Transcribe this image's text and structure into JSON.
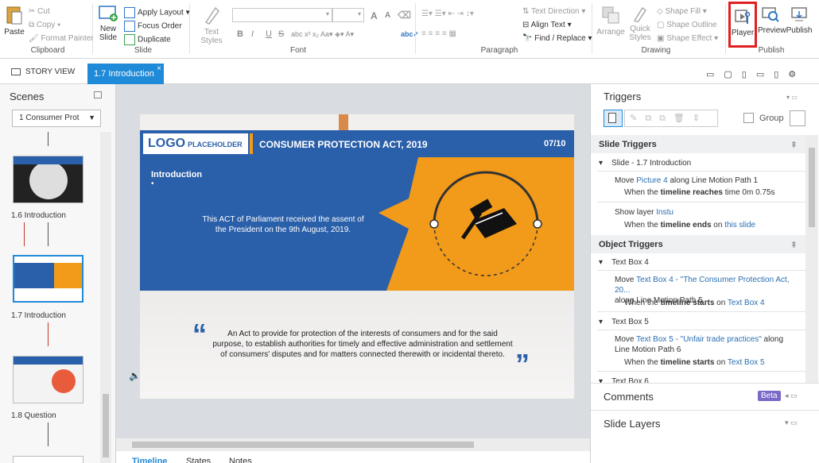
{
  "ribbon": {
    "clipboard": {
      "paste": "Paste",
      "cut": "Cut",
      "copy": "Copy",
      "format_painter": "Format Painter",
      "label": "Clipboard"
    },
    "slide": {
      "new_slide": "New",
      "new_slide2": "Slide",
      "apply_layout": "Apply Layout",
      "focus_order": "Focus Order",
      "duplicate": "Duplicate",
      "label": "Slide"
    },
    "font": {
      "text_styles": "Text Styles",
      "label": "Font",
      "bold": "B",
      "italic": "I",
      "underline": "U",
      "strike": "S",
      "grow": "A",
      "shrink": "A"
    },
    "paragraph": {
      "text_direction": "Text Direction",
      "align_text": "Align Text",
      "find_replace": "Find / Replace",
      "label": "Paragraph"
    },
    "drawing": {
      "arrange": "Arrange",
      "quick_styles": "Quick",
      "quick_styles2": "Styles",
      "shape_fill": "Shape Fill",
      "shape_outline": "Shape Outline",
      "shape_effect": "Shape Effect",
      "label": "Drawing"
    },
    "publish": {
      "player": "Player",
      "preview": "Preview",
      "publish": "Publish",
      "label": "Publish"
    }
  },
  "tabs": {
    "story_view": "STORY VIEW",
    "active": "1.7 Introduction",
    "close": "×"
  },
  "scenes": {
    "title": "Scenes",
    "selector": "1 Consumer Prot",
    "items": [
      {
        "label": "1.6 Introduction"
      },
      {
        "label": "1.7 Introduction"
      },
      {
        "label": "1.8 Question"
      }
    ]
  },
  "slide": {
    "logo": "LOGO",
    "logo_sub": "PLACEHOLDER",
    "header_title": "CONSUMER PROTECTION ACT, 2019",
    "page": "07/10",
    "intro_title": "Introduction",
    "bullet": "•",
    "intro_text_1": "This ACT of Parliament received the assent of",
    "intro_text_2": "the President on the 9th August, 2019.",
    "quote_1": "An Act to provide for protection of the interests of consumers and for the said",
    "quote_2": "purpose, to establish authorities for timely and effective administration and settlement",
    "quote_3": "of consumers' disputes and for matters connected therewith or incidental thereto.",
    "quote_open": "“",
    "quote_close": "”"
  },
  "bottom_tabs": {
    "timeline": "Timeline",
    "states": "States",
    "notes": "Notes"
  },
  "triggers": {
    "title": "Triggers",
    "group": "Group",
    "slide_triggers": "Slide Triggers",
    "slide_name": "Slide - 1.7 Introduction",
    "t1_a": "Move ",
    "t1_b": "Picture 4",
    "t1_c": " along Line Motion Path 1",
    "t1_when_a": "When the ",
    "t1_when_b": "timeline reaches",
    "t1_when_c": " time 0m 0.75s",
    "t2_a": "Show layer ",
    "t2_b": "Instu",
    "t2_when_a": "When the ",
    "t2_when_b": "timeline ends",
    "t2_when_c": " on ",
    "t2_when_d": "this slide",
    "object_triggers": "Object Triggers",
    "tb4": "Text Box 4",
    "t3_a": "Move ",
    "t3_b": "Text Box 4 - \"The Consumer Protection Act, 20...",
    "t3_c": "along Line Motion Path 5",
    "t3_when_a": "When the ",
    "t3_when_b": "timeline starts",
    "t3_when_c": " on ",
    "t3_when_d": "Text Box 4",
    "tb5": "Text Box 5",
    "t4_a": "Move ",
    "t4_b": "Text Box 5 - \"Unfair trade practices\"",
    "t4_c": " along",
    "t4_d": "Line Motion Path 6",
    "t4_when_a": "When the ",
    "t4_when_b": "timeline starts",
    "t4_when_c": " on ",
    "t4_when_d": "Text Box 5",
    "tb6": "Text Box 6",
    "comments": "Comments",
    "beta": "Beta",
    "slide_layers": "Slide Layers"
  },
  "colors": {
    "blue": "#2a5faa",
    "orange": "#f29a1a",
    "accent": "#1f8ad8",
    "highlight": "#e02020"
  }
}
